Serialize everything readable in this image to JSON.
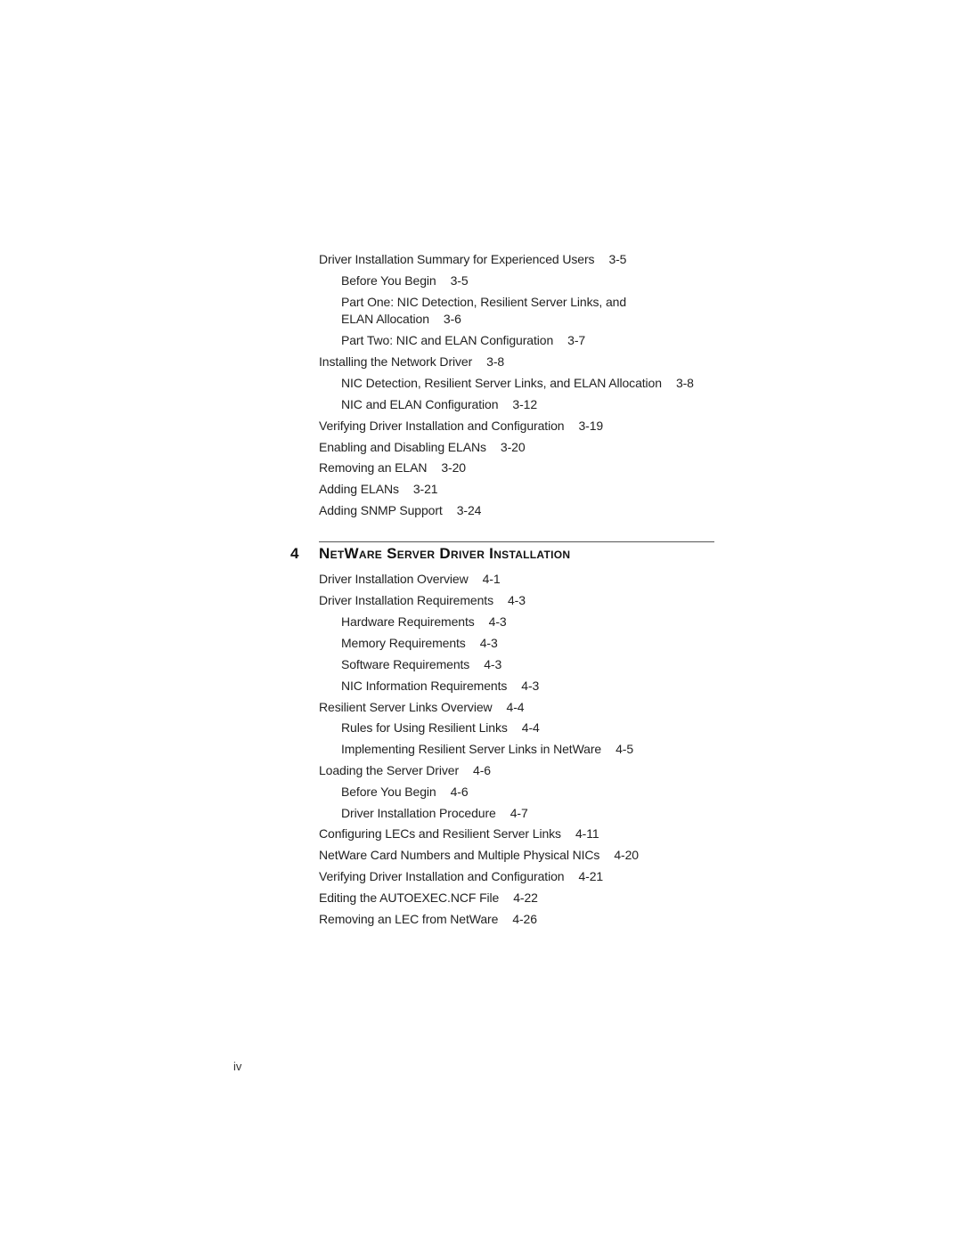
{
  "section_three_entries": [
    {
      "text": "Driver Installation Summary for Experienced Users",
      "page": "3-5",
      "level": 1
    },
    {
      "text": "Before You Begin",
      "page": "3-5",
      "level": 2
    },
    {
      "text": "Part One: NIC Detection, Resilient Server Links, and",
      "page": "",
      "level": 2
    },
    {
      "text": "ELAN Allocation",
      "page": "3-6",
      "level": 2
    },
    {
      "text": "Part Two: NIC and ELAN Configuration",
      "page": "3-7",
      "level": 2
    },
    {
      "text": "Installing the Network Driver",
      "page": "3-8",
      "level": 1
    },
    {
      "text": "NIC Detection, Resilient Server Links, and ELAN Allocation",
      "page": "3-8",
      "level": 2
    },
    {
      "text": "NIC and ELAN Configuration",
      "page": "3-12",
      "level": 2
    },
    {
      "text": "Verifying Driver Installation and Configuration",
      "page": "3-19",
      "level": 1
    },
    {
      "text": "Enabling and Disabling ELANs",
      "page": "3-20",
      "level": 1
    },
    {
      "text": "Removing an ELAN",
      "page": "3-20",
      "level": 1
    },
    {
      "text": "Adding ELANs",
      "page": "3-21",
      "level": 1
    },
    {
      "text": "Adding SNMP Support",
      "page": "3-24",
      "level": 1
    }
  ],
  "chapter": {
    "number": "4",
    "title": "NetWare Server Driver Installation"
  },
  "chapter_four_entries": [
    {
      "text": "Driver Installation Overview",
      "page": "4-1",
      "level": 1
    },
    {
      "text": "Driver Installation Requirements",
      "page": "4-3",
      "level": 1
    },
    {
      "text": "Hardware Requirements",
      "page": "4-3",
      "level": 2
    },
    {
      "text": "Memory Requirements",
      "page": "4-3",
      "level": 2
    },
    {
      "text": "Software Requirements",
      "page": "4-3",
      "level": 2
    },
    {
      "text": "NIC Information Requirements",
      "page": "4-3",
      "level": 2
    },
    {
      "text": "Resilient Server Links Overview",
      "page": "4-4",
      "level": 1
    },
    {
      "text": "Rules for Using Resilient Links",
      "page": "4-4",
      "level": 2
    },
    {
      "text": "Implementing Resilient Server Links in NetWare",
      "page": "4-5",
      "level": 2
    },
    {
      "text": "Loading the Server Driver",
      "page": "4-6",
      "level": 1
    },
    {
      "text": "Before You Begin",
      "page": "4-6",
      "level": 2
    },
    {
      "text": "Driver Installation Procedure",
      "page": "4-7",
      "level": 2
    },
    {
      "text": "Configuring LECs and Resilient Server Links",
      "page": "4-11",
      "level": 1
    },
    {
      "text": "NetWare Card Numbers and Multiple Physical NICs",
      "page": "4-20",
      "level": 1
    },
    {
      "text": "Verifying Driver Installation and Configuration",
      "page": "4-21",
      "level": 1
    },
    {
      "text": "Editing the AUTOEXEC.NCF File",
      "page": "4-22",
      "level": 1
    },
    {
      "text": "Removing an LEC from NetWare",
      "page": "4-26",
      "level": 1
    }
  ],
  "folio": "iv"
}
